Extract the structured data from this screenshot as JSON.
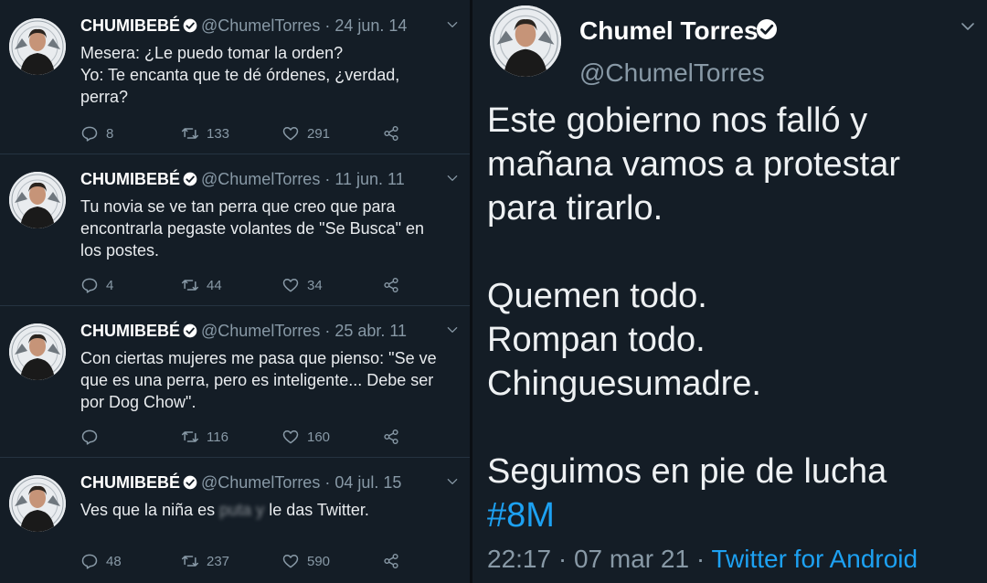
{
  "tweets": [
    {
      "name": "CHUMIBEBÉ",
      "handle": "@ChumelTorres",
      "date": "24 jun. 14",
      "lines": [
        "Mesera: ¿Le puedo tomar la orden?",
        "Yo: Te encanta que te dé órdenes, ¿verdad,",
        "perra?"
      ],
      "replies": "8",
      "retweets": "133",
      "likes": "291"
    },
    {
      "name": "CHUMIBEBÉ",
      "handle": "@ChumelTorres",
      "date": "11 jun. 11",
      "lines": [
        "Tu novia se ve tan perra que creo que para",
        "encontrarla pegaste volantes de \"Se Busca\" en",
        "los postes."
      ],
      "replies": "4",
      "retweets": "44",
      "likes": "34"
    },
    {
      "name": "CHUMIBEBÉ",
      "handle": "@ChumelTorres",
      "date": "25 abr. 11",
      "lines": [
        "Con ciertas mujeres me pasa que pienso: \"Se ve",
        "que es una perra, pero es inteligente... Debe ser",
        "por Dog Chow\"."
      ],
      "replies": "",
      "retweets": "116",
      "likes": "160"
    },
    {
      "name": "CHUMIBEBÉ",
      "handle": "@ChumelTorres",
      "date": "04 jul. 15",
      "line_pre": "Ves que la niña es",
      "line_blur": "puta y",
      "line_post": "le das Twitter.",
      "replies": "48",
      "retweets": "237",
      "likes": "590"
    }
  ],
  "main_tweet": {
    "name": "Chumel Torres",
    "handle": "@ChumelTorres",
    "lines": [
      "Este gobierno nos falló y",
      "mañana vamos a protestar",
      "para tirarlo.",
      "",
      "Quemen todo.",
      "Rompan todo.",
      "Chinguesumadre.",
      "",
      "Seguimos en pie de lucha"
    ],
    "hashtag": "#8M",
    "time": "22:17",
    "date": "07 mar 21",
    "source": "Twitter for Android"
  },
  "colors": {
    "background": "#141d26",
    "accent": "#1da1f2",
    "muted": "#8899a6"
  },
  "icons": [
    "reply-icon",
    "retweet-icon",
    "like-icon",
    "share-icon",
    "verified-icon",
    "chevron-down-icon"
  ]
}
